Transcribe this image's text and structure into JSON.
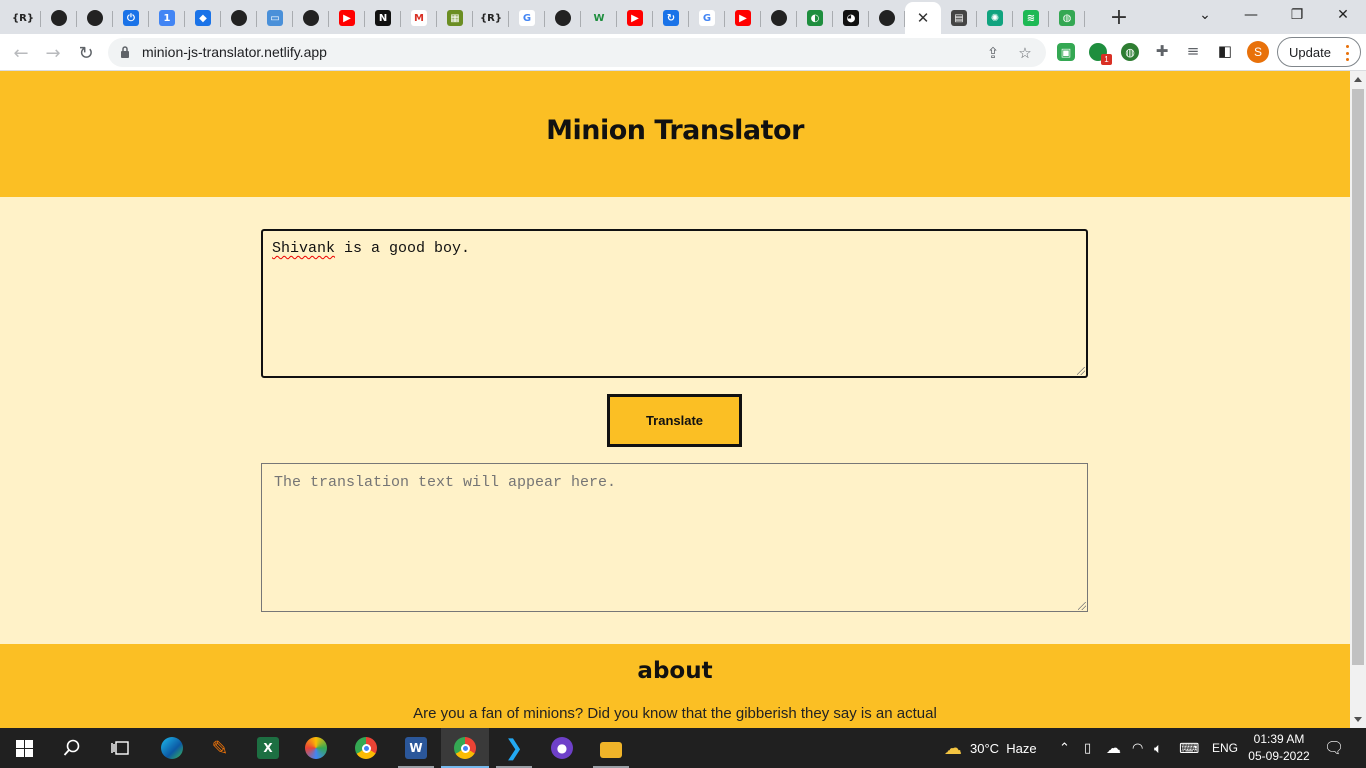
{
  "browser": {
    "tabs": [
      {
        "icon": "replit-icon",
        "glyph": "{R}",
        "color": "#dee1e6",
        "text_color": "#222"
      },
      {
        "icon": "github-icon",
        "glyph": "",
        "color": "#222",
        "text_color": "#fff"
      },
      {
        "icon": "github-icon",
        "glyph": "",
        "color": "#222",
        "text_color": "#fff"
      },
      {
        "icon": "power-icon",
        "glyph": "⏻",
        "color": "#1a73e8",
        "text_color": "#fff"
      },
      {
        "icon": "notification-icon",
        "glyph": "1",
        "color": "#4285f4",
        "text_color": "#fff"
      },
      {
        "icon": "diamond-icon",
        "glyph": "◆",
        "color": "#1a73e8",
        "text_color": "#fff"
      },
      {
        "icon": "github-icon",
        "glyph": "",
        "color": "#222",
        "text_color": "#fff"
      },
      {
        "icon": "laptop-icon",
        "glyph": "▭",
        "color": "#4a90d9",
        "text_color": "#fff"
      },
      {
        "icon": "github-icon",
        "glyph": "",
        "color": "#222",
        "text_color": "#fff"
      },
      {
        "icon": "youtube-icon",
        "glyph": "▶",
        "color": "#ff0000",
        "text_color": "#fff"
      },
      {
        "icon": "neog-icon",
        "glyph": "N",
        "color": "#111",
        "text_color": "#fff"
      },
      {
        "icon": "gmail-icon",
        "glyph": "M",
        "color": "#ffffff",
        "text_color": "#d93025"
      },
      {
        "icon": "image-icon",
        "glyph": "▦",
        "color": "#6b8e23",
        "text_color": "#fff"
      },
      {
        "icon": "replit-icon",
        "glyph": "{R}",
        "color": "#dee1e6",
        "text_color": "#222"
      },
      {
        "icon": "google-icon",
        "glyph": "G",
        "color": "#ffffff",
        "text_color": "#4285f4"
      },
      {
        "icon": "github-icon",
        "glyph": "",
        "color": "#222",
        "text_color": "#fff"
      },
      {
        "icon": "w-icon",
        "glyph": "W",
        "color": "#dee1e6",
        "text_color": "#1e8e3e"
      },
      {
        "icon": "youtube-icon",
        "glyph": "▶",
        "color": "#ff0000",
        "text_color": "#fff"
      },
      {
        "icon": "refresh-icon",
        "glyph": "↻",
        "color": "#1a73e8",
        "text_color": "#fff"
      },
      {
        "icon": "google-icon",
        "glyph": "G",
        "color": "#ffffff",
        "text_color": "#4285f4"
      },
      {
        "icon": "youtube-icon",
        "glyph": "▶",
        "color": "#ff0000",
        "text_color": "#fff"
      },
      {
        "icon": "github-icon",
        "glyph": "",
        "color": "#222",
        "text_color": "#fff"
      },
      {
        "icon": "circle-icon",
        "glyph": "◐",
        "color": "#1e8e3e",
        "text_color": "#fff"
      },
      {
        "icon": "cat-icon",
        "glyph": "◕",
        "color": "#111",
        "text_color": "#fff"
      },
      {
        "icon": "github-icon",
        "glyph": "",
        "color": "#222",
        "text_color": "#fff"
      },
      {
        "icon": "active-tab",
        "glyph": "",
        "color": "#fff",
        "text_color": "#333"
      },
      {
        "icon": "document-icon",
        "glyph": "▤",
        "color": "#444",
        "text_color": "#fff"
      },
      {
        "icon": "chatgpt-icon",
        "glyph": "✺",
        "color": "#10a37f",
        "text_color": "#fff"
      },
      {
        "icon": "spotify-icon",
        "glyph": "≋",
        "color": "#1db954",
        "text_color": "#fff"
      },
      {
        "icon": "globe-icon",
        "glyph": "◍",
        "color": "#34a853",
        "text_color": "#fff"
      }
    ],
    "url": "minion-js-translator.netlify.app",
    "profile_initial": "S",
    "update_label": "Update",
    "extension_badge": "1"
  },
  "page": {
    "title": "Minion Translator",
    "input_text_misspelled": "Shivank",
    "input_text_rest": " is a good boy.",
    "translate_label": "Translate",
    "output_placeholder": "The translation text will appear here.",
    "about_title": "about",
    "about_text": "Are you a fan of minions? Did you know that the gibberish they say is an actual"
  },
  "taskbar": {
    "weather": "30°C  Haze",
    "language": "ENG",
    "time": "01:39 AM",
    "date": "05-09-2022"
  },
  "colors": {
    "header": "#fbbf24",
    "background": "#fff2c8"
  }
}
